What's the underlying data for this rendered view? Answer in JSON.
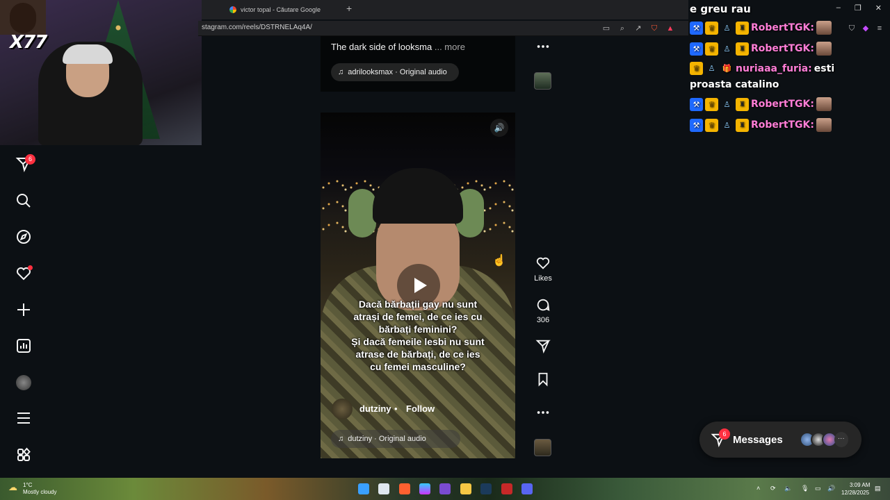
{
  "webcam": {
    "tag": "X77"
  },
  "browser": {
    "tab_title": "victor topal - Căutare Google",
    "new_tab_icon": "plus-icon",
    "url": "stagram.com/reels/DSTRNELAq4A/"
  },
  "sidebar": {
    "direct_badge": "6",
    "items": [
      "direct-icon",
      "search-icon",
      "explore-icon",
      "notifications-heart-icon",
      "create-plus-icon",
      "insights-chart-icon",
      "profile-avatar",
      "menu-icon",
      "apps-grid-icon"
    ]
  },
  "reel1": {
    "caption": "The dark side of looksma",
    "more": "... more",
    "audio": "adrilooksmax · Original audio"
  },
  "reel2": {
    "subtitles": [
      "Dacă bărbații gay nu sunt",
      "atrași de femei, de ce ies cu",
      "bărbați feminini?",
      "Și dacă femeile lesbi nu sunt",
      "atrase de bărbați, de ce ies",
      "cu femei masculine?"
    ],
    "author": "dutziny",
    "dot": "•",
    "follow": "Follow",
    "audio": "dutziny · Original audio"
  },
  "actions": {
    "likes_label": "Likes",
    "comments_count": "306"
  },
  "chat": {
    "title": "e greu rau",
    "lines": [
      {
        "user": "RobertTGK:"
      },
      {
        "user": "RobertTGK:"
      },
      {
        "user": "nuriaaa_furia:",
        "msg_a": "esti",
        "msg_b": "proasta catalino"
      },
      {
        "user": "RobertTGK:"
      },
      {
        "user": "RobertTGK:"
      }
    ]
  },
  "messages": {
    "label": "Messages",
    "badge": "6",
    "more": "···"
  },
  "taskbar": {
    "temperature": "1°C",
    "condition": "Mostly cloudy",
    "time": "3:09 AM",
    "date": "12/28/2025"
  },
  "colors": {
    "notification_red": "#ff3040",
    "background": "#0c1014",
    "chat_username": "#ff7dd6"
  }
}
